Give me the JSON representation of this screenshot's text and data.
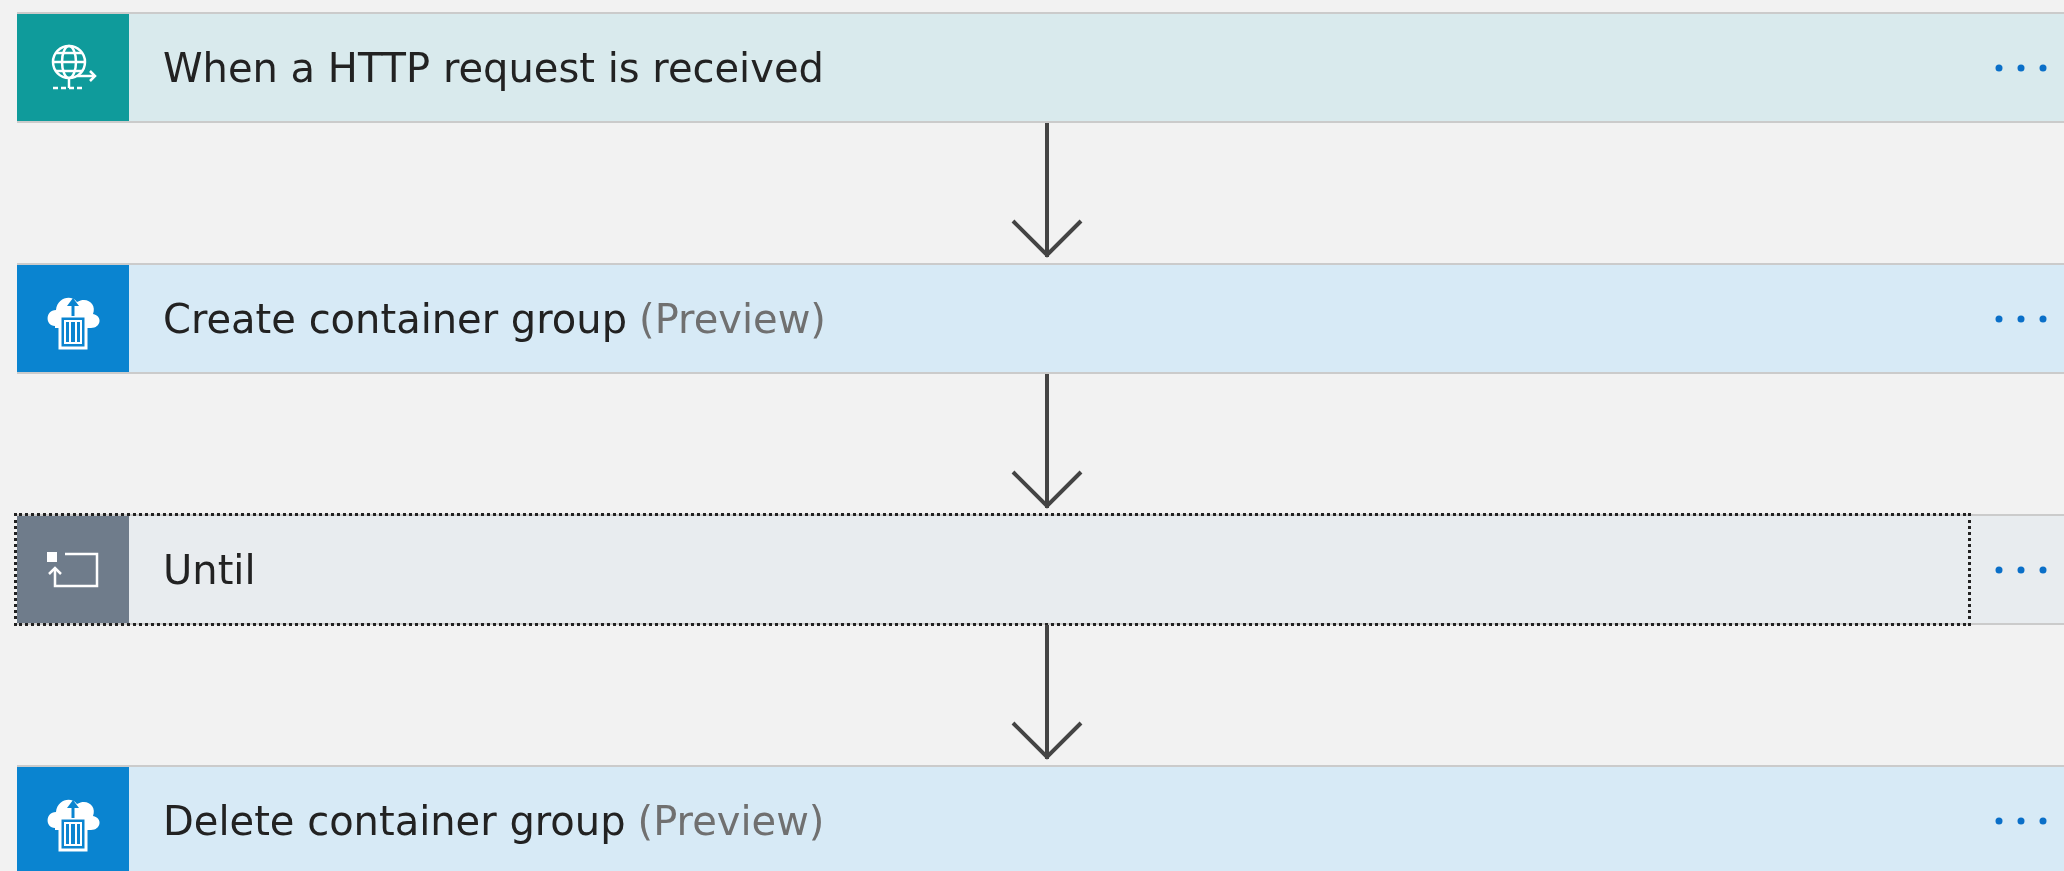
{
  "steps": [
    {
      "kind": "trigger",
      "title": "When a HTTP request is received",
      "focused": false
    },
    {
      "kind": "container",
      "title": "Create container group",
      "suffix": "(Preview)",
      "focused": false
    },
    {
      "kind": "loop",
      "title": "Until",
      "focused": true
    },
    {
      "kind": "container",
      "title": "Delete container group",
      "suffix": "(Preview)",
      "focused": false
    }
  ]
}
